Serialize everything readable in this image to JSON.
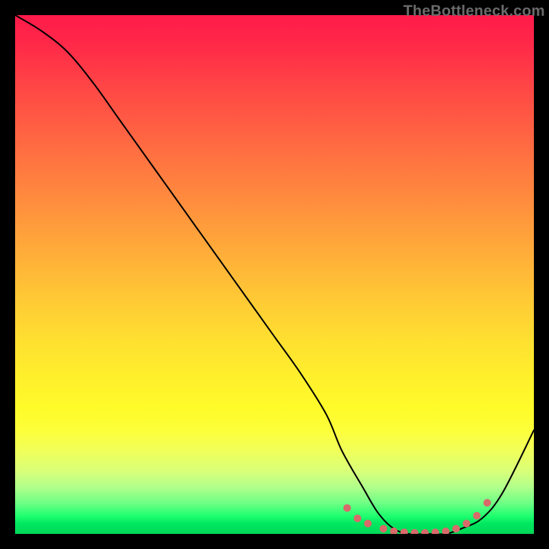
{
  "watermark": "TheBottleneck.com",
  "chart_data": {
    "type": "line",
    "title": "",
    "xlabel": "",
    "ylabel": "",
    "xlim": [
      0,
      100
    ],
    "ylim": [
      0,
      100
    ],
    "series": [
      {
        "name": "bottleneck-curve",
        "x": [
          0,
          5,
          10,
          15,
          20,
          25,
          30,
          35,
          40,
          45,
          50,
          55,
          60,
          63,
          67,
          70,
          73,
          76,
          80,
          83,
          86,
          90,
          94,
          100
        ],
        "y": [
          100,
          97,
          93,
          87,
          80,
          73,
          66,
          59,
          52,
          45,
          38,
          31,
          23,
          16,
          9,
          4,
          1,
          0,
          0,
          0,
          1,
          3,
          8,
          20
        ]
      }
    ],
    "markers": {
      "name": "highlight-dots",
      "x": [
        64,
        66,
        68,
        71,
        73,
        75,
        77,
        79,
        81,
        83,
        85,
        87,
        89,
        91
      ],
      "y": [
        5,
        3,
        2,
        1,
        0.5,
        0.3,
        0.2,
        0.2,
        0.3,
        0.5,
        1,
        2,
        3.5,
        6
      ]
    },
    "gradient_stops": [
      {
        "pos": 0,
        "color": "#ff1a4a"
      },
      {
        "pos": 50,
        "color": "#ffca35"
      },
      {
        "pos": 80,
        "color": "#fdff3a"
      },
      {
        "pos": 100,
        "color": "#00d858"
      }
    ]
  }
}
